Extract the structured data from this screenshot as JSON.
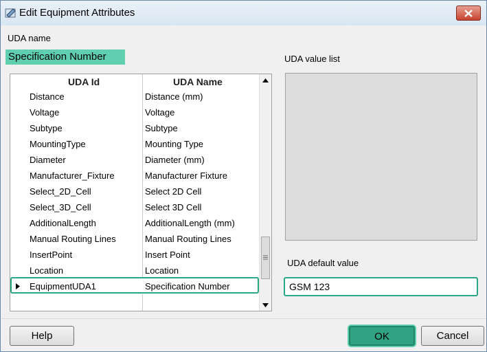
{
  "window": {
    "title": "Edit Equipment Attributes"
  },
  "uda_name": {
    "label": "UDA name",
    "value": "Specification Number"
  },
  "grid": {
    "headers": {
      "id": "UDA Id",
      "name": "UDA Name"
    },
    "rows": [
      {
        "id": "Distance",
        "name": "Distance (mm)"
      },
      {
        "id": "Voltage",
        "name": "Voltage"
      },
      {
        "id": "Subtype",
        "name": "Subtype"
      },
      {
        "id": "MountingType",
        "name": "Mounting Type"
      },
      {
        "id": "Diameter",
        "name": "Diameter (mm)"
      },
      {
        "id": "Manufacturer_Fixture",
        "name": "Manufacturer Fixture"
      },
      {
        "id": "Select_2D_Cell",
        "name": "Select 2D Cell"
      },
      {
        "id": "Select_3D_Cell",
        "name": "Select 3D Cell"
      },
      {
        "id": "AdditionalLength",
        "name": "AdditionalLength (mm)"
      },
      {
        "id": "Manual Routing Lines",
        "name": "Manual Routing Lines"
      },
      {
        "id": "InsertPoint",
        "name": "Insert Point"
      },
      {
        "id": "Location",
        "name": "Location"
      },
      {
        "id": "EquipmentUDA1",
        "name": "Specification Number"
      }
    ],
    "selected_index": 12
  },
  "value_list": {
    "label": "UDA value list"
  },
  "default_value": {
    "label": "UDA default value",
    "value": "GSM 123"
  },
  "buttons": {
    "help": "Help",
    "ok": "OK",
    "cancel": "Cancel"
  },
  "colors": {
    "highlight": "#5fcfb0",
    "accent_border": "#2aa785",
    "ok_button": "#2fa382"
  }
}
